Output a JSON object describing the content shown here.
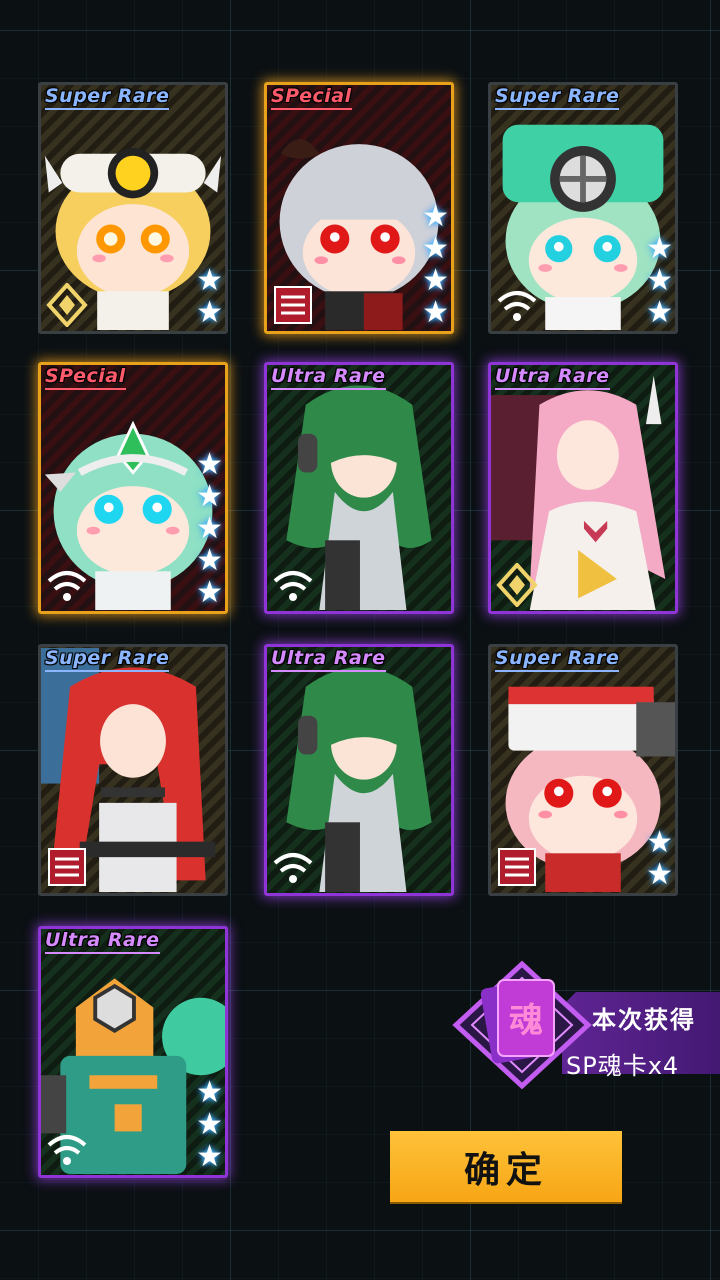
{
  "cards": [
    {
      "rarity_label": "Super Rare",
      "rarity": "super",
      "stars": 2,
      "element": "diamond-element-icon",
      "character": "blonde chibi with yellow-eye goggle helmet"
    },
    {
      "rarity_label": "SPecial",
      "rarity": "special",
      "stars": 4,
      "element": "ribbon-element-icon",
      "character": "silver-haired chibi with red eyes"
    },
    {
      "rarity_label": "Super Rare",
      "rarity": "super",
      "stars": 3,
      "element": "wifi-element-icon",
      "character": "mint-haired chibi with fan helmet"
    },
    {
      "rarity_label": "SPecial",
      "rarity": "special",
      "stars": 5,
      "element": "wifi-element-icon",
      "character": "mint-haired chibi with crystal tiara"
    },
    {
      "rarity_label": "Ultra Rare",
      "rarity": "ultra",
      "stars": 0,
      "element": "wifi-element-icon",
      "character": "green-haired girl with headphones"
    },
    {
      "rarity_label": "Ultra Rare",
      "rarity": "ultra",
      "stars": 0,
      "element": "diamond-element-icon",
      "character": "pink-haired girl with heart mecha"
    },
    {
      "rarity_label": "Super Rare",
      "rarity": "super",
      "stars": 0,
      "element": "ribbon-element-icon",
      "character": "red twin-tail girl with chain collar"
    },
    {
      "rarity_label": "Ultra Rare",
      "rarity": "ultra",
      "stars": 0,
      "element": "wifi-element-icon",
      "character": "green-haired girl with headphones"
    },
    {
      "rarity_label": "Super Rare",
      "rarity": "super",
      "stars": 2,
      "element": "ribbon-element-icon",
      "character": "pink-haired chibi with white cap"
    },
    {
      "rarity_label": "Ultra Rare",
      "rarity": "ultra",
      "stars": 3,
      "element": "wifi-element-icon",
      "character": "green and orange mecha"
    }
  ],
  "reward": {
    "label": "本次获得",
    "value": "SP魂卡x4",
    "icon_glyph": "魂"
  },
  "confirm_label": "确定",
  "colors": {
    "special_border": "#e7a11a",
    "ultra_border": "#8f35d8",
    "super_rare_text": "#8bb6ff",
    "special_text": "#ff5a6b",
    "ultra_text": "#d58bff",
    "button": "#f7a615"
  }
}
